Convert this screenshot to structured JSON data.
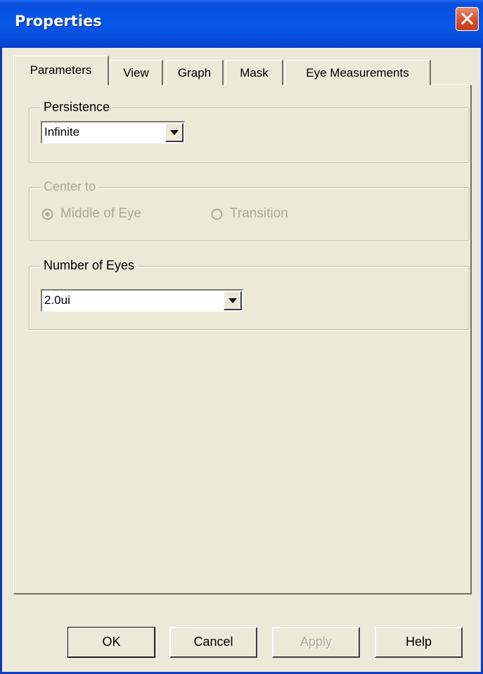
{
  "window": {
    "title": "Properties"
  },
  "tabs": [
    {
      "label": "Parameters"
    },
    {
      "label": "View"
    },
    {
      "label": "Graph"
    },
    {
      "label": "Mask"
    },
    {
      "label": "Eye Measurements"
    }
  ],
  "persistence": {
    "legend": "Persistence",
    "value": "Infinite"
  },
  "center_to": {
    "legend": "Center to",
    "options": [
      {
        "label": "Middle of Eye",
        "selected": true
      },
      {
        "label": "Transition",
        "selected": false
      }
    ]
  },
  "number_of_eyes": {
    "legend": "Number of Eyes",
    "value": "2.0ui"
  },
  "buttons": {
    "ok": "OK",
    "cancel": "Cancel",
    "apply": "Apply",
    "help": "Help"
  },
  "colors": {
    "title_bar": "#0758e8",
    "dialog_bg": "#ece9d8",
    "disabled_text": "#aca899",
    "close_button": "#d4502c"
  },
  "icons": {
    "close": "close-icon",
    "dropdown": "chevron-down-icon",
    "radio": "radio-icon"
  }
}
